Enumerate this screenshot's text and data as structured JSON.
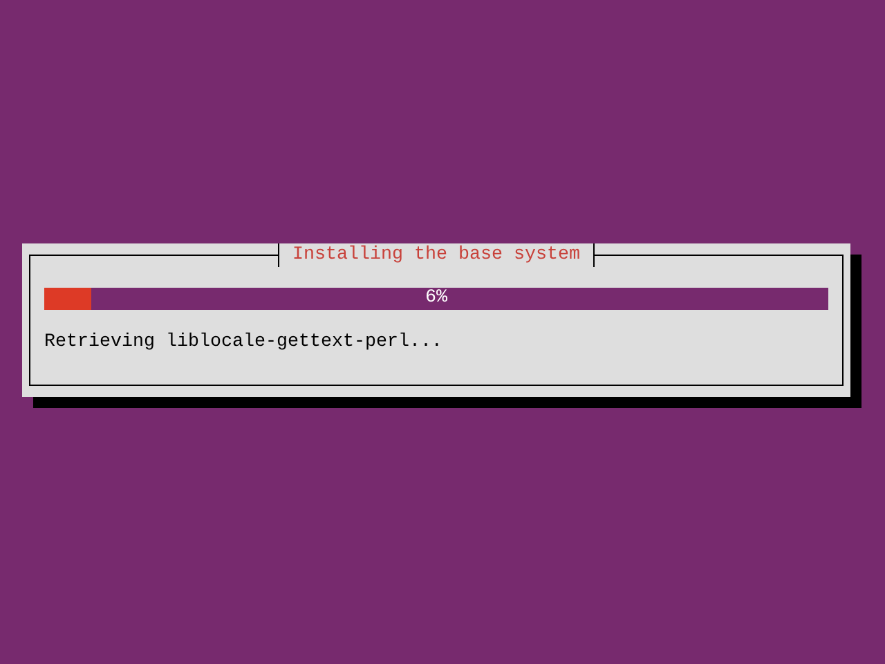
{
  "dialog": {
    "title": "Installing the base system",
    "progress": {
      "level": 0.06,
      "reading": "6%"
    },
    "message": "Retrieving liblocale-gettext-perl..."
  }
}
